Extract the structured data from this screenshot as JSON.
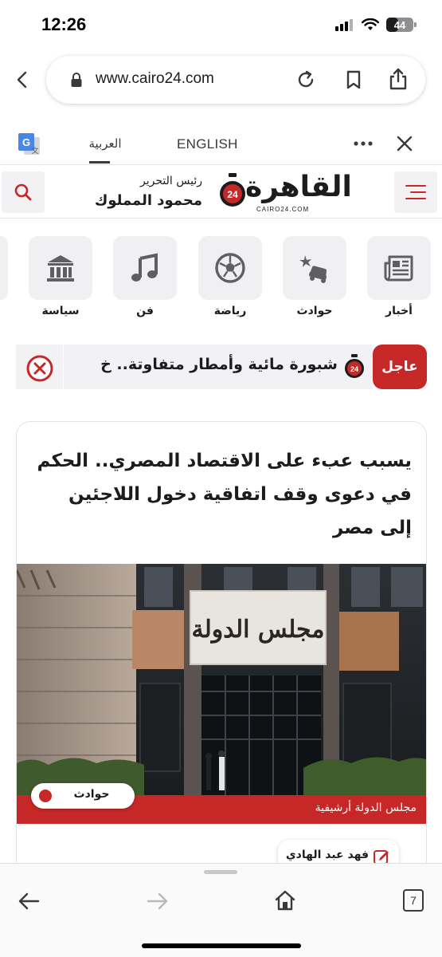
{
  "status_bar": {
    "time": "12:26",
    "battery_level": "44",
    "battery_fraction": 0.44
  },
  "browser": {
    "url": "www.cairo24.com"
  },
  "translate_bar": {
    "tab_arabic": "العربية",
    "tab_english": "ENGLISH",
    "active_tab": "arabic"
  },
  "site_header": {
    "editor_label": "رئيس التحرير",
    "editor_name": "محمود المملوك",
    "logo_text": "القاهرة",
    "logo_badge": "24",
    "logo_sub": "CAIRO24.COM"
  },
  "categories": [
    {
      "label": "أخبار",
      "icon": "newspaper-icon"
    },
    {
      "label": "حوادث",
      "icon": "car-crash-icon"
    },
    {
      "label": "رياضة",
      "icon": "football-icon"
    },
    {
      "label": "فن",
      "icon": "music-note-icon"
    },
    {
      "label": "سياسة",
      "icon": "government-building-icon"
    }
  ],
  "ticker": {
    "badge": "عاجل",
    "text": "شبورة مائية وأمطار متفاوتة.. خ"
  },
  "article": {
    "title": "يسبب عبء على الاقتصاد المصري.. الحكم في دعوى وقف اتفاقية دخول اللاجئين إلى مصر",
    "image_sign_text": "مجلس الدولة",
    "image_caption": "مجلس الدولة أرشيفية",
    "category": "حوادث",
    "author": "فهد عبد الهادي"
  },
  "bottom_bar": {
    "tab_count": "7"
  },
  "colors": {
    "accent_red": "#c62828",
    "tile_gray": "#f0f0f2"
  }
}
